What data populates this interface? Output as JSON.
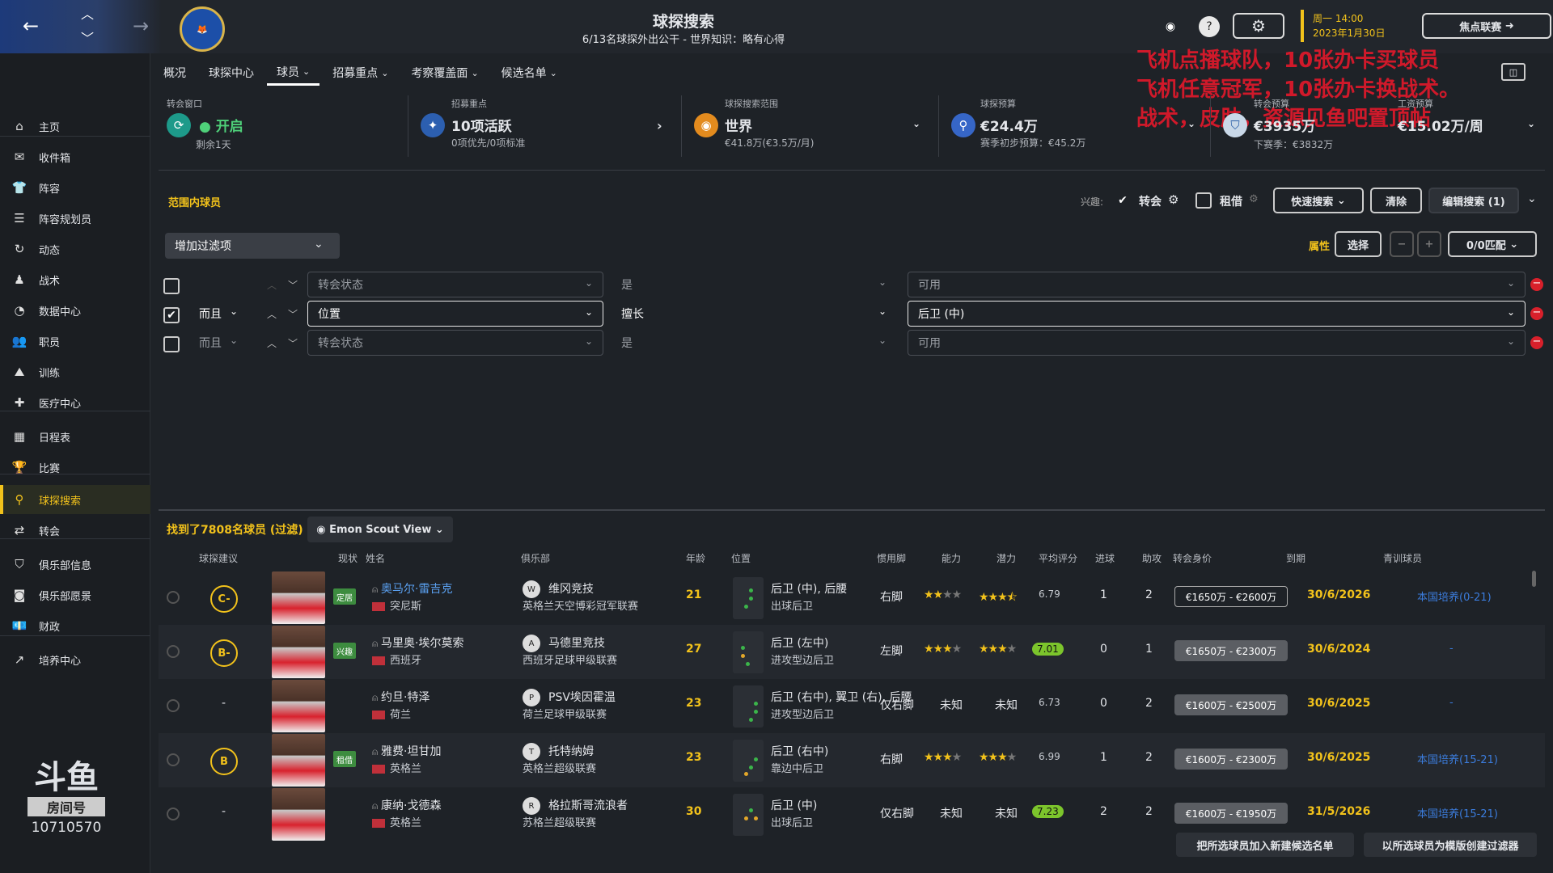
{
  "header": {
    "title": "球探搜索",
    "subtitle": "6/13名球探外出公干 - 世界知识：略有心得",
    "date_line1": "周一 14:00",
    "date_line2": "2023年1月30日",
    "focus_button": "焦点联赛"
  },
  "sidebar": {
    "items": [
      "主页",
      "收件箱",
      "阵容",
      "阵容规划员",
      "动态",
      "战术",
      "数据中心",
      "职员",
      "训练",
      "医疗中心",
      "日程表",
      "比赛",
      "球探搜索",
      "转会",
      "俱乐部信息",
      "俱乐部愿景",
      "财政",
      "培养中心"
    ],
    "active_index": 12
  },
  "watermark": {
    "room_label": "房间号",
    "room_number": "10710570"
  },
  "tabs": [
    "概况",
    "球探中心",
    "球员",
    "招募重点",
    "考察覆盖面",
    "候选名单"
  ],
  "overlay_lines": [
    "飞机点播球队，10张办卡买球员",
    "飞机任意冠军，10张办卡换战术。",
    "战术，皮肤，资源见鱼吧置顶帖"
  ],
  "info": {
    "transfer_window": {
      "label": "转会窗口",
      "value": "开启",
      "sub": "剩余1天"
    },
    "focus": {
      "label": "招募重点",
      "value": "10项活跃",
      "sub": "0项优先/0项标准"
    },
    "range": {
      "label": "球探搜索范围",
      "value": "世界",
      "sub": "€41.8万(€3.5万/月)"
    },
    "budget": {
      "label": "球探预算",
      "value": "€24.4万",
      "sub": "赛季初步预算：€45.2万"
    },
    "transfer_budget": {
      "label": "转会预算",
      "value": "€3935万",
      "sub": "下赛季：€3832万"
    },
    "wage_budget": {
      "label": "工资预算",
      "value": "€15.02万/周"
    }
  },
  "filters": {
    "range_label": "范围内球员",
    "interest_label": "兴趣:",
    "transfer_label": "转会",
    "loan_label": "租借",
    "quick_search": "快速搜索",
    "clear": "清除",
    "edit_search": "编辑搜索 (1)",
    "add_filter": "增加过滤项",
    "attributes_label": "属性",
    "choose": "选择",
    "match": "0/0匹配",
    "rows": [
      {
        "checked": false,
        "conj": "",
        "field": "转会状态",
        "op": "是",
        "value": "可用"
      },
      {
        "checked": true,
        "conj": "而且",
        "field": "位置",
        "op": "擅长",
        "value": "后卫 (中)"
      },
      {
        "checked": false,
        "conj": "而且",
        "field": "转会状态",
        "op": "是",
        "value": "可用"
      }
    ]
  },
  "results": {
    "summary": "找到了7808名球员 (过滤)",
    "view": "Emon Scout View",
    "columns": [
      "球探建议",
      "现状",
      "姓名",
      "俱乐部",
      "年龄",
      "位置",
      "惯用脚",
      "能力",
      "潜力",
      "平均评分",
      "进球",
      "助攻",
      "转会身价",
      "到期",
      "青训球员"
    ],
    "players": [
      {
        "grade": "C-",
        "status": "定居",
        "name": "奥马尔·雷吉克",
        "nat": "突尼斯",
        "club": "维冈竞技",
        "league": "英格兰天空博彩冠军联赛",
        "age": "21",
        "pos1": "后卫 (中), 后腰",
        "pos2": "出球后卫",
        "foot": "右脚",
        "ability": 2,
        "potential": 3.5,
        "ability_text": "",
        "potential_text": "",
        "rating": "6.79",
        "rating_hl": false,
        "goals": "1",
        "assists": "2",
        "value": "€1650万 - €2600万",
        "value_outline": true,
        "expiry": "30/6/2026",
        "youth": "本国培养(0-21)",
        "club_icon": "W"
      },
      {
        "grade": "B-",
        "status": "兴趣",
        "name": "马里奥·埃尔莫索",
        "nat": "西班牙",
        "club": "马德里竞技",
        "league": "西班牙足球甲级联赛",
        "age": "27",
        "pos1": "后卫 (左中)",
        "pos2": "进攻型边后卫",
        "foot": "左脚",
        "ability": 3,
        "potential": 3,
        "ability_text": "",
        "potential_text": "",
        "rating": "7.01",
        "rating_hl": true,
        "goals": "0",
        "assists": "1",
        "value": "€1650万 - €2300万",
        "value_outline": false,
        "expiry": "30/6/2024",
        "youth": "-",
        "club_icon": "A"
      },
      {
        "grade": "-",
        "status": "",
        "name": "约旦·特泽",
        "nat": "荷兰",
        "club": "PSV埃因霍温",
        "league": "荷兰足球甲级联赛",
        "age": "23",
        "pos1": "后卫 (右中), 翼卫 (右), 后腰",
        "pos2": "进攻型边后卫",
        "foot": "仅右脚",
        "ability": 0,
        "potential": 0,
        "ability_text": "未知",
        "potential_text": "未知",
        "rating": "6.73",
        "rating_hl": false,
        "goals": "0",
        "assists": "2",
        "value": "€1600万 - €2500万",
        "value_outline": false,
        "expiry": "30/6/2025",
        "youth": "-",
        "club_icon": "P"
      },
      {
        "grade": "B",
        "status": "租借",
        "name": "雅费·坦甘加",
        "nat": "英格兰",
        "club": "托特纳姆",
        "league": "英格兰超级联赛",
        "age": "23",
        "pos1": "后卫 (右中)",
        "pos2": "靠边中后卫",
        "foot": "右脚",
        "ability": 3,
        "potential": 3,
        "ability_text": "",
        "potential_text": "",
        "rating": "6.99",
        "rating_hl": false,
        "goals": "1",
        "assists": "2",
        "value": "€1600万 - €2300万",
        "value_outline": false,
        "expiry": "30/6/2025",
        "youth": "本国培养(15-21)",
        "club_icon": "T"
      },
      {
        "grade": "-",
        "status": "",
        "name": "康纳·戈德森",
        "nat": "英格兰",
        "club": "格拉斯哥流浪者",
        "league": "苏格兰超级联赛",
        "age": "30",
        "pos1": "后卫 (中)",
        "pos2": "出球后卫",
        "foot": "仅右脚",
        "ability": 0,
        "potential": 0,
        "ability_text": "未知",
        "potential_text": "未知",
        "rating": "7.23",
        "rating_hl": true,
        "goals": "2",
        "assists": "2",
        "value": "€1600万 - €1950万",
        "value_outline": false,
        "expiry": "31/5/2026",
        "youth": "本国培养(15-21)",
        "club_icon": "R"
      }
    ]
  },
  "bottom": {
    "add_shortlist": "把所选球员加入新建候选名单",
    "create_filter": "以所选球员为模版创建过滤器"
  }
}
